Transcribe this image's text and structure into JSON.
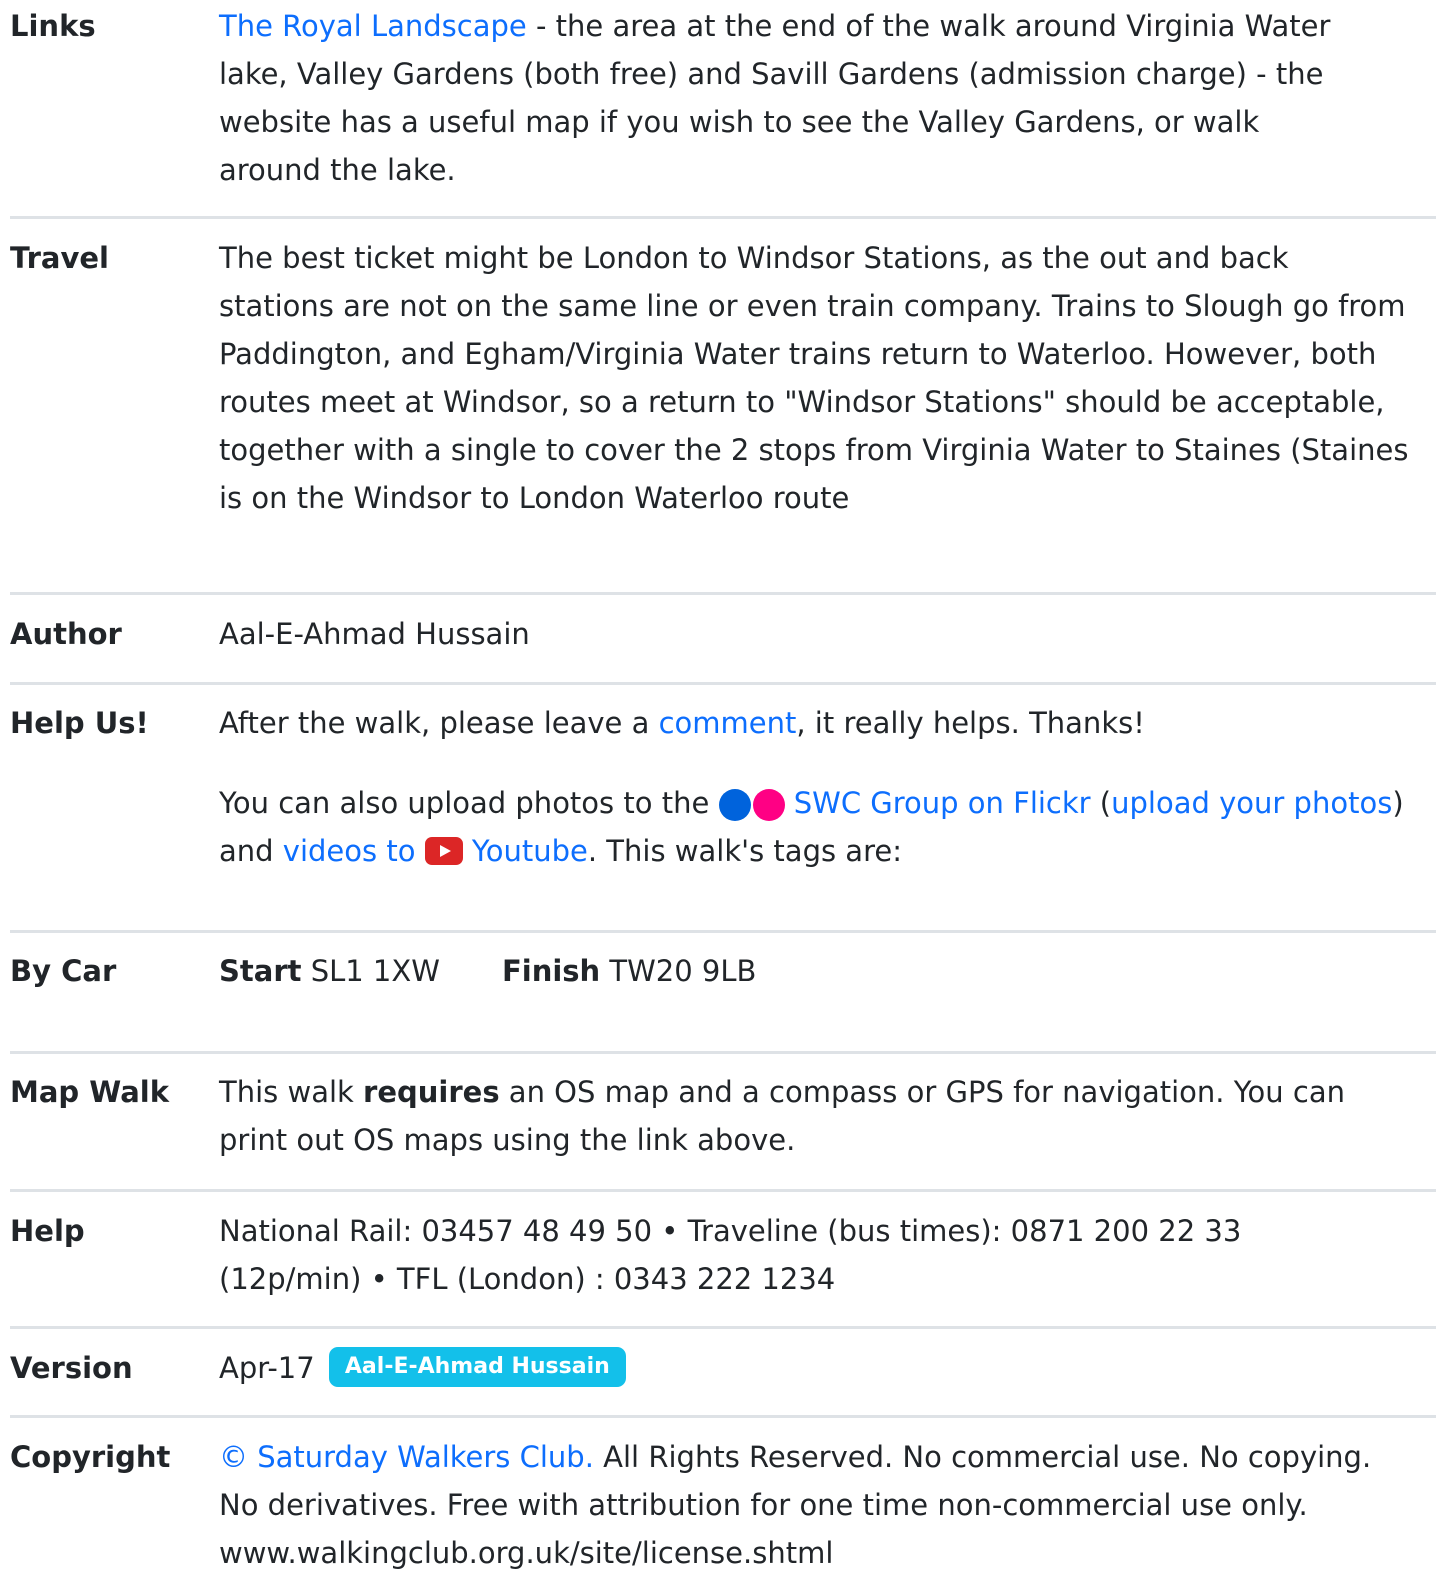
{
  "colors": {
    "link": "#0d6efd",
    "divider": "#dee2e6",
    "text": "#212529",
    "flickr_blue": "#0063dc",
    "flickr_pink": "#ff0084",
    "youtube_red": "#dc2626",
    "badge_bg": "#13c0ea"
  },
  "rows": {
    "links": {
      "label": "Links",
      "link_text": "The Royal Landscape",
      "text": " - the area at the end of the walk around Virginia Water lake, Valley Gardens (both free) and Savill Gardens (admission charge) - the website has a useful map if you wish to see the Valley Gardens, or walk around the lake."
    },
    "travel": {
      "label": "Travel",
      "text": "The best ticket might be London to Windsor Stations, as the out and back stations are not on the same line or even train company. Trains to Slough go from Paddington, and Egham/Virginia Water trains return to Waterloo. However, both routes meet at Windsor, so a return to \"Windsor Stations\" should be acceptable, together with a single to cover the 2 stops from Virginia Water to Staines (Staines is on the Windsor to London Waterloo route"
    },
    "author": {
      "label": "Author",
      "text": "Aal-E-Ahmad Hussain"
    },
    "help_us": {
      "label": "Help Us!",
      "p1_before": "After the walk, please leave a ",
      "p1_link": "comment",
      "p1_after": ", it really helps. Thanks!",
      "p2_before": "You can also upload photos to the ",
      "flickr_icon": "flickr-icon",
      "flickr_link": "SWC Group on Flickr",
      "p2_open_paren": " (",
      "upload_link": "upload your photos",
      "p2_and": ") and ",
      "videos_link": "videos to",
      "youtube_icon": "youtube-icon",
      "youtube_link": "Youtube",
      "p2_after": ". This walk's tags are:"
    },
    "by_car": {
      "label": "By Car",
      "start_label": "Start",
      "start_value": "SL1 1XW",
      "finish_label": "Finish",
      "finish_value": "TW20 9LB"
    },
    "map_walk": {
      "label": "Map Walk",
      "before": "This walk ",
      "bold": "requires",
      "after": " an OS map and a compass or GPS for navigation. You can print out OS maps using the link above."
    },
    "help": {
      "label": "Help",
      "text": "National Rail: 03457 48 49 50 • Traveline (bus times): 0871 200 22 33 (12p/min) • TFL (London) : 0343 222 1234"
    },
    "version": {
      "label": "Version",
      "date": "Apr-17",
      "badge": "Aal-E-Ahmad Hussain"
    },
    "copyright": {
      "label": "Copyright",
      "link_text": "© Saturday Walkers Club.",
      "text": " All Rights Reserved. No commercial use. No copying. No derivatives. Free with attribution for one time non-commercial use only. www.walkingclub.org.uk/site/license.shtml"
    }
  }
}
